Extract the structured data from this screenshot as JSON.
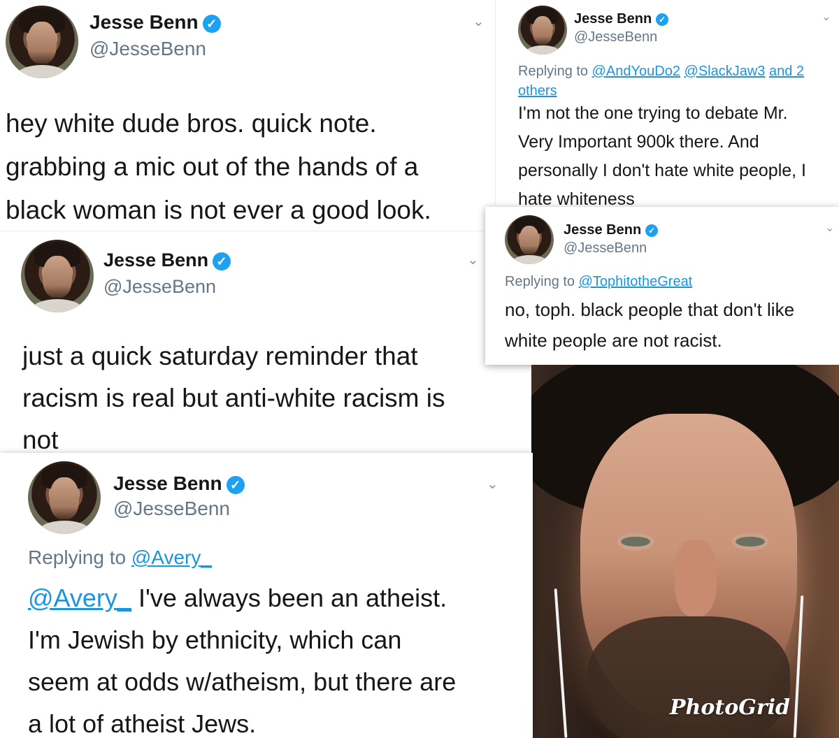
{
  "user": {
    "name": "Jesse Benn",
    "handle": "@JesseBenn"
  },
  "icons": {
    "verified": "verified-badge-icon",
    "chevron": "chevron-down-icon"
  },
  "tweets": [
    {
      "lines": [
        "hey white dude bros. quick note.",
        "grabbing a mic out of the hands of a",
        "black woman is not ever a good look."
      ]
    },
    {
      "reply_prefix": "Replying to ",
      "reply_to_1": "@AndYouDo2",
      "reply_to_2": "@SlackJaw3",
      "reply_to_more_a": "and 2",
      "reply_to_more_b": "others",
      "lines": [
        "I'm not the one trying to debate Mr.",
        "Very Important 900k there. And",
        "personally I don't hate white people, I",
        "hate whiteness"
      ]
    },
    {
      "lines": [
        "just a quick saturday reminder that",
        "racism is real but anti-white racism is",
        "not"
      ]
    },
    {
      "reply_prefix": "Replying to ",
      "reply_to_1": "@TophitotheGreat",
      "lines": [
        "no, toph. black people that don't like",
        "white people are not racist."
      ]
    },
    {
      "reply_prefix": "Replying to ",
      "reply_to_1": "@Avery_",
      "mention": "@Avery_",
      "lines": [
        "I've always been an atheist.",
        "I'm Jewish by ethnicity, which can",
        "seem at odds w/atheism, but there are",
        "a lot of atheist Jews."
      ]
    }
  ],
  "photo": {
    "watermark": "PhotoGrid"
  },
  "colors": {
    "link": "#1b95e0",
    "verified": "#1da1f2",
    "muted": "#657786"
  }
}
